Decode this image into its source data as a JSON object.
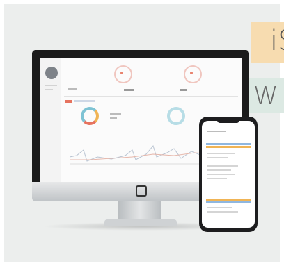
{
  "banner": {
    "line1": "iS",
    "line2": "W"
  },
  "colors": {
    "banner1": "#f7dcb0",
    "banner2": "#dce9e3",
    "accent_red": "#e6735f",
    "accent_blue": "#7ec3d4",
    "accent_orange": "#f0b455"
  },
  "icons": {
    "apple_logo": "apple-logo-icon"
  }
}
